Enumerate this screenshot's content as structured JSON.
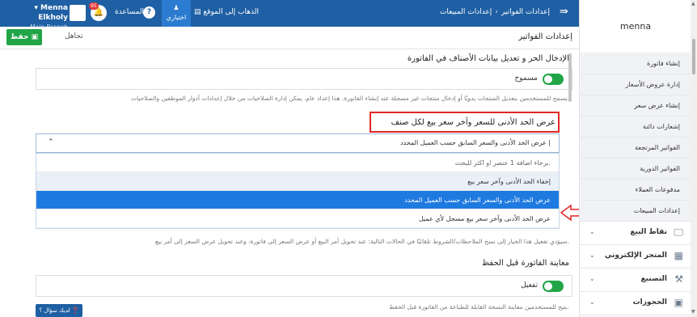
{
  "topbar": {
    "user_name": "Menna Elkholy",
    "user_caret": "▾",
    "branch": "Main Branch",
    "notification_count": "95",
    "help_label": "المساعدة",
    "preferences_label": "اختياري",
    "goto_site_label": "الذهاب إلى الموقع",
    "breadcrumb": [
      "إعدادات المبيعات",
      "إعدادات الفواتير"
    ]
  },
  "subbar": {
    "save_label": "حفظ",
    "ignore_label": "تجاهل",
    "page_title": "إعدادات الفواتير"
  },
  "settings": {
    "free_entry": {
      "title": "الإدخال الحر و تعديل بيانات الأصناف في الفاتورة",
      "toggle_label": "مسموح",
      "hint": "يسمح للمستخدمين بتعديل المنتجات يدويًا أو إدخال منتجات غير مسجلة عند إنشاء الفاتورة. هذا إعداد عام، يمكن إدارة الصلاحيات من خلال إعدادات أدوار الموظفين والصلاحيات."
    },
    "min_price": {
      "title": "عرض الحد الأدنى للسعر وآخر سعر بيع لكل صنف",
      "selected_value": "عرض الحد الأدنى والسعر السابق حسب العميل المحدد |",
      "options": [
        "برجاء اضافة 1 عنصر او اكثر للبحث.",
        "إخفاء الحد الأدنى وآخر سعر بيع",
        "عرض الحد الأدنى والسعر السابق حسب العميل المحدد",
        "عرض الحد الأدنى وآخر سعر بيع مسجل لأي عميل"
      ],
      "hint": "سيؤدي تفعيل هذا الخيار إلى نسخ الملاحظات/الشروط تلقائيًا في الحالات التالية: عند تحويل أمر البيع أو عرض السعر إلى فاتورة، وعند تحويل عرض السعر إلى أمر بيع."
    },
    "preview": {
      "title": "معاينة الفاتورة قبل الحفظ",
      "toggle_label": "تفعيل",
      "hint": "يتيح للمستخدمين معاينة النسخة القابلة للطباعة من الفاتورة قبل الحفظ."
    },
    "ask_button": "لديك سؤال ؟"
  },
  "sidebar": {
    "brand": "menna",
    "items": [
      "إنشاء فاتورة",
      "إدارة عروض الأسعار",
      "إنشاء عرض سعر",
      "إشعارات دائنة",
      "الفواتير المرتجعة",
      "الفواتير الدورية",
      "مدفوعات العملاء",
      "إعدادات المبيعات"
    ],
    "groups": [
      {
        "label": "نقاط البيع",
        "icon": "pos-icon",
        "glyph": "🖵"
      },
      {
        "label": "المتجر الإلكتروني",
        "icon": "store-icon",
        "glyph": "▦"
      },
      {
        "label": "التصنيع",
        "icon": "tools-icon",
        "glyph": "⚒"
      },
      {
        "label": "الحجوزات",
        "icon": "calendar-icon",
        "glyph": "▣"
      }
    ]
  },
  "colors": {
    "topbar": "#1f5fa3",
    "save": "#21a547",
    "selected_option": "#1f7ae0",
    "highlight_border": "#e32525"
  }
}
